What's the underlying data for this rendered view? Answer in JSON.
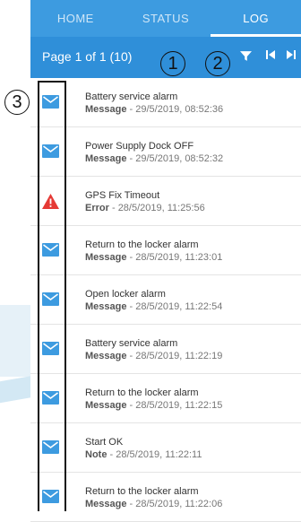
{
  "tabs": [
    {
      "label": "HOME",
      "active": false
    },
    {
      "label": "STATUS",
      "active": false
    },
    {
      "label": "LOG",
      "active": true
    }
  ],
  "toolbar": {
    "page_info": "Page 1 of 1 (10)",
    "icons": [
      "filter-icon",
      "first-page-icon",
      "last-page-icon"
    ]
  },
  "callouts": [
    "1",
    "2",
    "3"
  ],
  "colors": {
    "tab_bar": "#3d9be0",
    "toolbar": "#2f8fd9",
    "message_icon": "#3d9be0",
    "error_icon": "#e53935"
  },
  "log_entries": [
    {
      "title": "Battery service alarm",
      "type": "Message",
      "timestamp": "29/5/2019, 08:52:36",
      "icon": "envelope-icon"
    },
    {
      "title": "Power Supply Dock OFF",
      "type": "Message",
      "timestamp": "29/5/2019, 08:52:32",
      "icon": "envelope-icon"
    },
    {
      "title": "GPS Fix Timeout",
      "type": "Error",
      "timestamp": "28/5/2019, 11:25:56",
      "icon": "warning-icon"
    },
    {
      "title": "Return to the locker alarm",
      "type": "Message",
      "timestamp": "28/5/2019, 11:23:01",
      "icon": "envelope-icon"
    },
    {
      "title": "Open locker alarm",
      "type": "Message",
      "timestamp": "28/5/2019, 11:22:54",
      "icon": "envelope-icon"
    },
    {
      "title": "Battery service alarm",
      "type": "Message",
      "timestamp": "28/5/2019, 11:22:19",
      "icon": "envelope-icon"
    },
    {
      "title": "Return to the locker alarm",
      "type": "Message",
      "timestamp": "28/5/2019, 11:22:15",
      "icon": "envelope-icon"
    },
    {
      "title": "Start OK",
      "type": "Note",
      "timestamp": "28/5/2019, 11:22:11",
      "icon": "envelope-icon"
    },
    {
      "title": "Return to the locker alarm",
      "type": "Message",
      "timestamp": "28/5/2019, 11:22:06",
      "icon": "envelope-icon"
    }
  ]
}
